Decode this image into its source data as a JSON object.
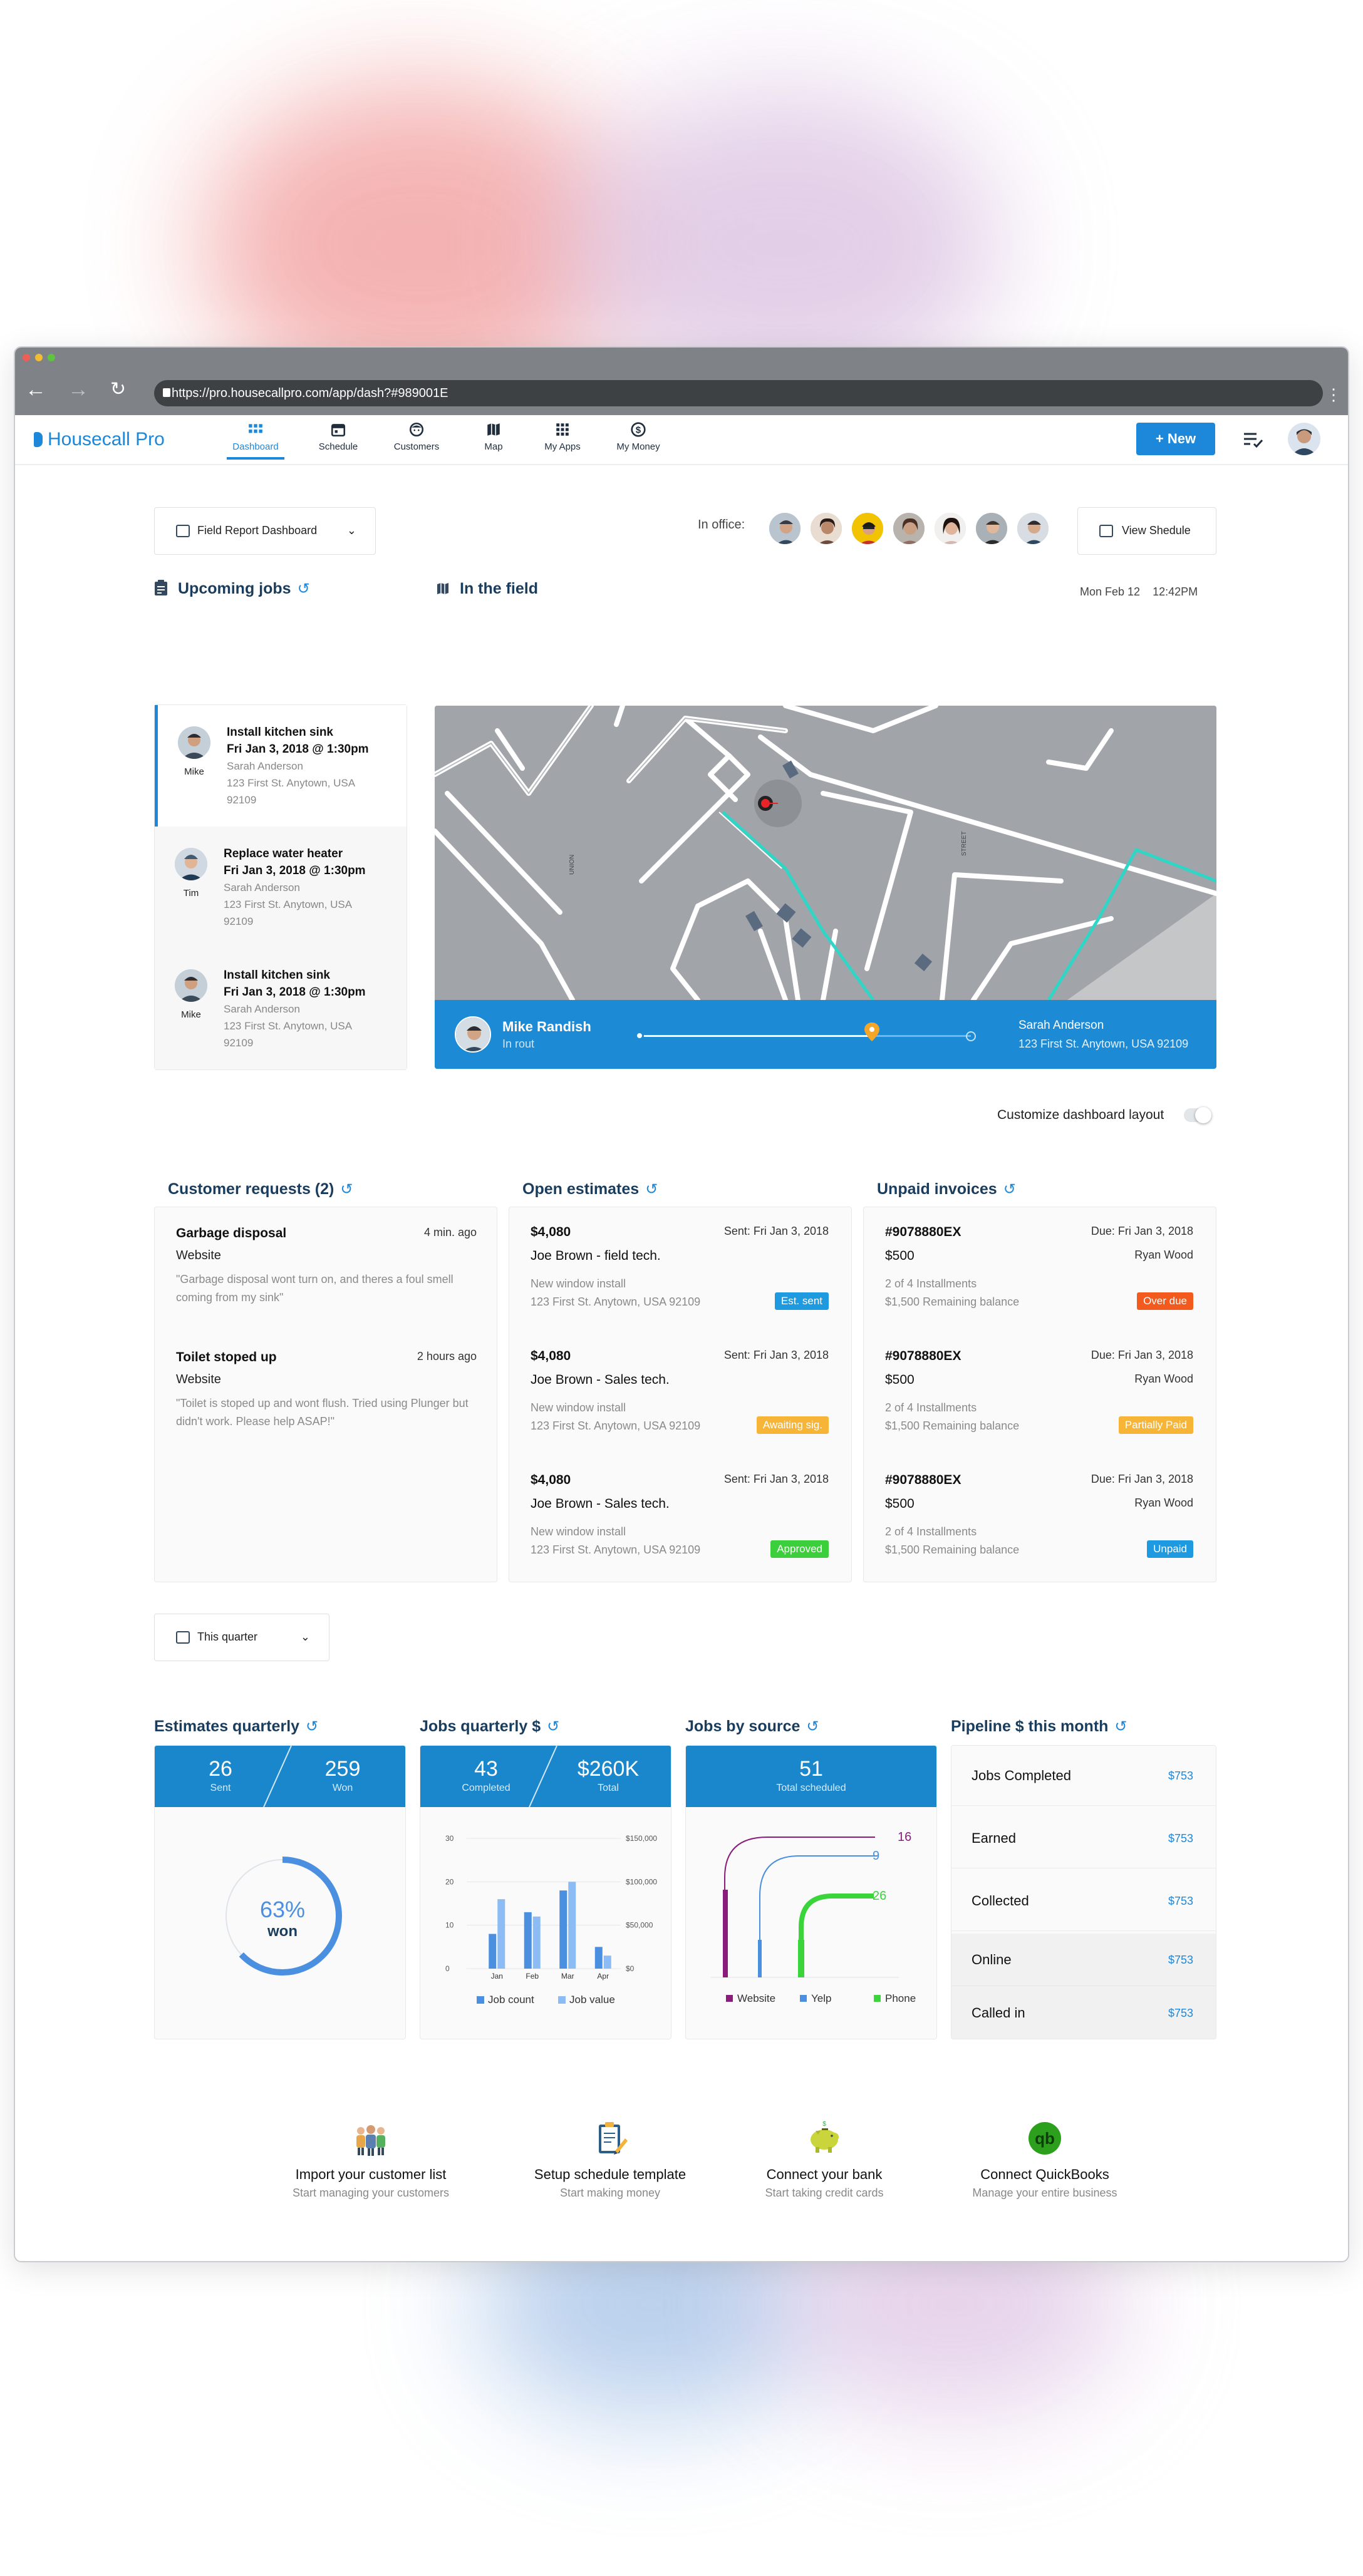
{
  "browser": {
    "url": "https://pro.housecallpro.com/app/dash?#989001E"
  },
  "nav": {
    "brand": "Housecall Pro",
    "items": [
      {
        "label": "Dashboard",
        "icon": "grid-icon"
      },
      {
        "label": "Schedule",
        "icon": "calendar-icon"
      },
      {
        "label": "Customers",
        "icon": "customer-face-icon"
      },
      {
        "label": "Map",
        "icon": "map-icon"
      },
      {
        "label": "My Apps",
        "icon": "apps-grid-icon"
      },
      {
        "label": "My Money",
        "icon": "dollar-coin-icon"
      }
    ],
    "new_button": "+ New"
  },
  "report_dropdown": "Field Report Dashboard",
  "in_office_label": "In office:",
  "view_schedule": "View Shedule",
  "upcoming": {
    "title": "Upcoming jobs",
    "jobs": [
      {
        "title": "Install kitchen sink",
        "when": "Fri Jan 3, 2018  @  1:30pm",
        "customer": "Sarah Anderson",
        "address": "123 First St. Anytown, USA",
        "zip": "92109",
        "tech": "Mike"
      },
      {
        "title": "Replace water heater",
        "when": "Fri Jan 3, 2018  @  1:30pm",
        "customer": "Sarah Anderson",
        "address": "123 First St. Anytown, USA",
        "zip": "92109",
        "tech": "Tim"
      },
      {
        "title": "Install kitchen sink",
        "when": "Fri Jan 3, 2018  @  1:30pm",
        "customer": "Sarah Anderson",
        "address": "123 First St. Anytown, USA",
        "zip": "92109",
        "tech": "Mike"
      }
    ]
  },
  "field": {
    "title": "In the field",
    "date": "Mon Feb 12",
    "time": "12:42PM",
    "tech_name": "Mike Randish",
    "tech_status": "In rout",
    "customer": "Sarah Anderson",
    "address": "123 First St. Anytown, USA 92109",
    "route_progress": 0.72,
    "street_labels": [
      "UNION",
      "STREET"
    ]
  },
  "customize_label": "Customize dashboard layout",
  "requests": {
    "title": "Customer requests (2)",
    "items": [
      {
        "title": "Garbage disposal",
        "time": "4 min. ago",
        "source": "Website",
        "desc": "\"Garbage disposal wont turn on, and theres a foul smell coming from my sink\""
      },
      {
        "title": "Toilet stoped up",
        "time": "2 hours ago",
        "source": "Website",
        "desc": "\"Toilet is stoped up and wont flush. Tried using Plunger but didn't work. Please help ASAP!\""
      }
    ]
  },
  "estimates": {
    "title": "Open estimates",
    "items": [
      {
        "amount": "$4,080",
        "sent": "Sent: Fri Jan 3, 2018",
        "who": "Joe Brown - field tech.",
        "desc": "New window install",
        "address": "123 First St. Anytown, USA 92109",
        "status": "Est. sent",
        "color": "#1d9ae0"
      },
      {
        "amount": "$4,080",
        "sent": "Sent: Fri Jan 3, 2018",
        "who": "Joe Brown - Sales tech.",
        "desc": "New window install",
        "address": "123 First St. Anytown, USA 92109",
        "status": "Awaiting sig.",
        "color": "#f7b538"
      },
      {
        "amount": "$4,080",
        "sent": "Sent: Fri Jan 3, 2018",
        "who": "Joe Brown - Sales tech.",
        "desc": "New window install",
        "address": "123 First St. Anytown, USA 92109",
        "status": "Approved",
        "color": "#3ccf3c"
      }
    ]
  },
  "invoices": {
    "title": "Unpaid invoices",
    "items": [
      {
        "number": "#9078880EX",
        "due": "Due: Fri Jan 3, 2018",
        "amount": "$500",
        "who": "Ryan Wood",
        "installments": "2 of 4 Installments",
        "balance": "$1,500 Remaining balance",
        "status": "Over due",
        "color": "#f25b1d"
      },
      {
        "number": "#9078880EX",
        "due": "Due: Fri Jan 3, 2018",
        "amount": "$500",
        "who": "Ryan Wood",
        "installments": "2 of 4 Installments",
        "balance": "$1,500 Remaining balance",
        "status": "Partially Paid",
        "color": "#f7b538"
      },
      {
        "number": "#9078880EX",
        "due": "Due: Fri Jan 3, 2018",
        "amount": "$500",
        "who": "Ryan Wood",
        "installments": "2 of 4 Installments",
        "balance": "$1,500 Remaining balance",
        "status": "Unpaid",
        "color": "#1d9ae0"
      }
    ]
  },
  "period_dropdown": "This quarter",
  "est_quarterly": {
    "title": "Estimates quarterly",
    "sent": "26",
    "sent_label": "Sent",
    "won": "259",
    "won_label": "Won",
    "pct": "63%",
    "pct_label": "won",
    "pct_value": 0.63
  },
  "jobs_quarterly": {
    "title": "Jobs quarterly $",
    "completed": "43",
    "completed_label": "Completed",
    "total": "$260K",
    "total_label": "Total"
  },
  "jobs_source": {
    "title": "Jobs by source",
    "total": "51",
    "total_label": "Total scheduled"
  },
  "pipeline": {
    "title": "Pipeline $ this month",
    "rows": [
      {
        "label": "Jobs Completed",
        "value": "$753"
      },
      {
        "label": "Earned",
        "value": "$753"
      },
      {
        "label": "Collected",
        "value": "$753"
      },
      {
        "label": "Online",
        "value": "$753"
      },
      {
        "label": "Called in",
        "value": "$753"
      }
    ]
  },
  "onboarding": [
    {
      "title": "Import your customer list",
      "sub": "Start managing your customers",
      "icon": "people-icon"
    },
    {
      "title": "Setup schedule template",
      "sub": "Start making money",
      "icon": "clipboard-icon"
    },
    {
      "title": "Connect your bank",
      "sub": "Start taking credit cards",
      "icon": "piggy-bank-icon"
    },
    {
      "title": "Connect QuickBooks",
      "sub": "Manage your entire business",
      "icon": "quickbooks-icon"
    }
  ],
  "chart_data": [
    {
      "type": "bar",
      "categories": [
        "Jan",
        "Feb",
        "Mar",
        "Apr"
      ],
      "series": [
        {
          "name": "Job count",
          "values": [
            8,
            13,
            18,
            5
          ]
        },
        {
          "name": "Job value",
          "values": [
            16,
            12,
            20,
            3
          ]
        }
      ],
      "ylim": [
        0,
        30
      ],
      "y_ticks": [
        "0",
        "10",
        "20",
        "30"
      ],
      "y2_ticks": [
        "$0",
        "$50,000",
        "$100,000",
        "$150,000"
      ],
      "colors": [
        "#4a8fe0",
        "#8dbcf5"
      ]
    },
    {
      "type": "line",
      "series": [
        {
          "name": "Website",
          "value": "16",
          "color": "#8a1c7c"
        },
        {
          "name": "Yelp",
          "value": "9",
          "color": "#4a8fe0"
        },
        {
          "name": "Phone",
          "value": "26",
          "color": "#3bd43b"
        }
      ]
    }
  ]
}
